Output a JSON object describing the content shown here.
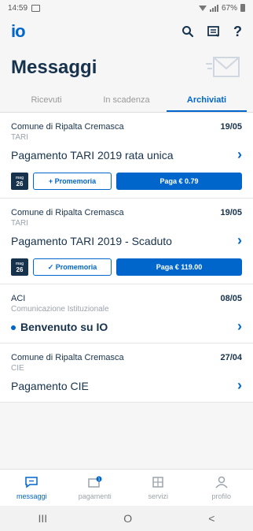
{
  "status": {
    "time": "14:59",
    "battery": "67%"
  },
  "appbar": {
    "logo": "io",
    "search_icon": "search-icon",
    "inbox_icon": "inbox-icon",
    "help_label": "?"
  },
  "page": {
    "title": "Messaggi",
    "envelope_icon": "envelope-icon"
  },
  "tabs": [
    {
      "label": "Ricevuti"
    },
    {
      "label": "In scadenza"
    },
    {
      "label": "Archiviati"
    }
  ],
  "messages": [
    {
      "sender": "Comune di Ripalta Cremasca",
      "date": "19/05",
      "service": "TARI",
      "subject": "Pagamento TARI 2019 rata unica",
      "calendar_day": "26",
      "reminder_label": "+ Promemoria",
      "pay_label": "Paga € 0.79"
    },
    {
      "sender": "Comune di Ripalta Cremasca",
      "date": "19/05",
      "service": "TARI",
      "subject": "Pagamento TARI 2019 - Scaduto",
      "calendar_day": "26",
      "reminder_label": "✓ Promemoria",
      "pay_label": "Paga € 119.00"
    },
    {
      "sender": "ACI",
      "date": "08/05",
      "service": "Comunicazione Istituzionale",
      "subject": "Benvenuto su IO"
    },
    {
      "sender": "Comune di Ripalta Cremasca",
      "date": "27/04",
      "service": "CIE",
      "subject": "Pagamento CIE"
    }
  ],
  "bottomnav": [
    {
      "label": "messaggi"
    },
    {
      "label": "pagamenti"
    },
    {
      "label": "servizi"
    },
    {
      "label": "profilo"
    }
  ],
  "sysnav": {
    "recent": "III",
    "home": "O",
    "back": "<"
  },
  "colors": {
    "accent": "#0066cc",
    "text_dark": "#17324d"
  }
}
